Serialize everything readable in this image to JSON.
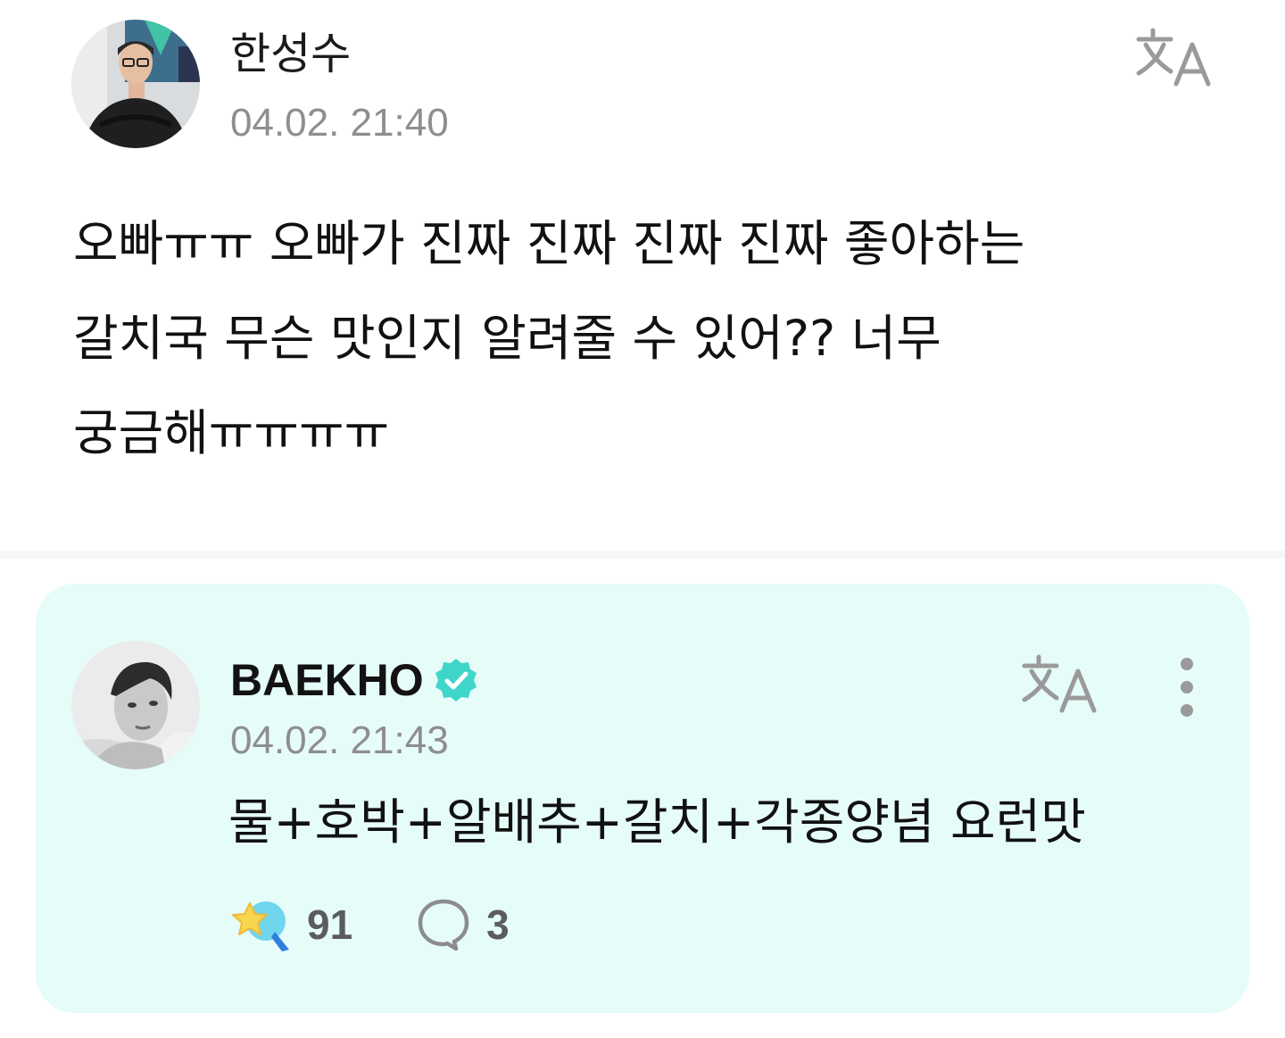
{
  "post": {
    "author_name": "한성수",
    "timestamp": "04.02. 21:40",
    "body": "오빠ㅠㅠ 오빠가 진짜 진짜 진짜 진짜 좋아하는\n갈치국 무슨 맛인지 알려줄 수 있어?? 너무\n궁금해ㅠㅠㅠㅠ",
    "translate_icon": "translate-icon"
  },
  "reply": {
    "author_name": "BAEKHO",
    "verified_icon": "verified-badge-icon",
    "timestamp": "04.02. 21:43",
    "body": "물+호박+알배추+갈치+각종양념 요런맛",
    "translate_icon": "translate-icon",
    "more_icon": "more-vertical-icon",
    "like_count": "91",
    "like_icon": "reaction-star-icon",
    "comment_count": "3",
    "comment_icon": "comment-bubble-icon"
  },
  "colors": {
    "reply_background": "#e6fcf9",
    "verified": "#3fd6c9",
    "timestamp": "#8e8e8e",
    "icon": "#9a9a9a"
  }
}
